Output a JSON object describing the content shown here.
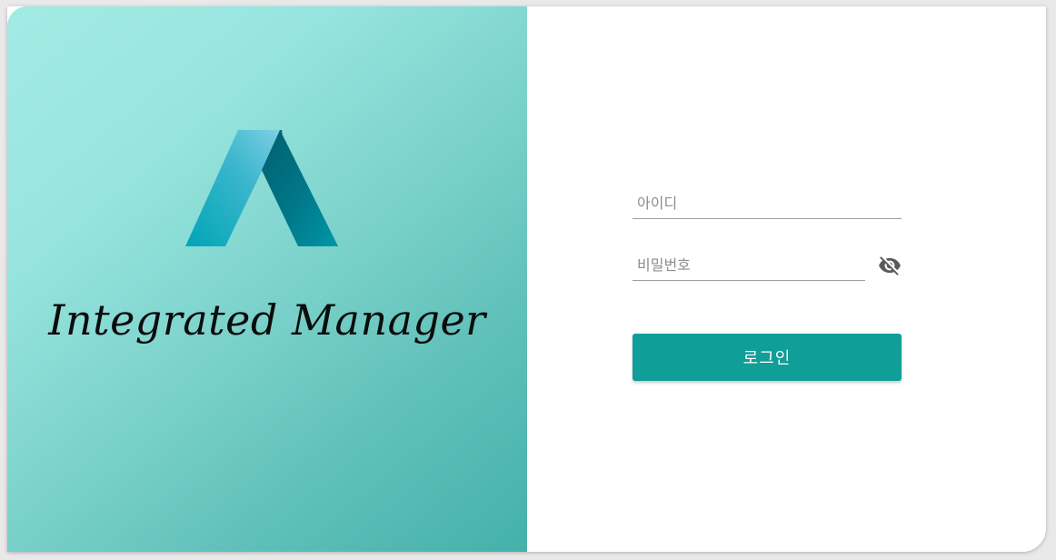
{
  "brand": {
    "title": "Integrated Manager",
    "logo_icon": "stylized-a-logo-icon",
    "logo_colors": {
      "light": "#5cc2d6",
      "dark": "#007283"
    }
  },
  "login_form": {
    "id_placeholder": "아이디",
    "id_value": "",
    "password_placeholder": "비밀번호",
    "password_value": "",
    "visibility_icon": "eye-off-icon",
    "submit_label": "로그인"
  },
  "colors": {
    "accent": "#0f9e98",
    "panel_gradient_start": "#a3ebe4",
    "panel_gradient_end": "#44b1aa"
  }
}
